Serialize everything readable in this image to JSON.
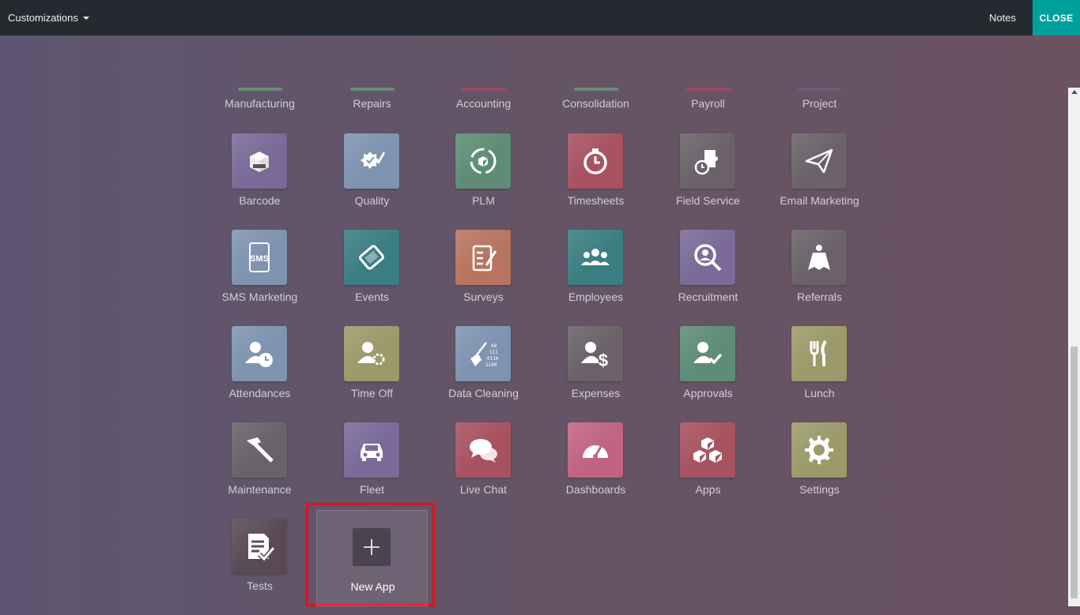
{
  "topbar": {
    "menu_label": "Customizations",
    "notes_label": "Notes",
    "close_label": "CLOSE"
  },
  "partial_row": [
    {
      "label": "Manufacturing",
      "color": "#6a8a74"
    },
    {
      "label": "Repairs",
      "color": "#6a8a74"
    },
    {
      "label": "Accounting",
      "color": "#9a4a62"
    },
    {
      "label": "Consolidation",
      "color": "#6a8a74"
    },
    {
      "label": "Payroll",
      "color": "#9a4a62"
    },
    {
      "label": "Project",
      "color": "#6a5a7a"
    }
  ],
  "apps": [
    {
      "label": "Barcode",
      "icon": "barcode-box-icon",
      "color": "#7a6a98"
    },
    {
      "label": "Quality",
      "icon": "quality-badge-icon",
      "color": "#7e93b0"
    },
    {
      "label": "PLM",
      "icon": "plm-cycle-icon",
      "color": "#5e8c76"
    },
    {
      "label": "Timesheets",
      "icon": "stopwatch-icon",
      "color": "#a85260"
    },
    {
      "label": "Field Service",
      "icon": "puzzle-stopwatch-icon",
      "color": "#6a6268"
    },
    {
      "label": "Email Marketing",
      "icon": "paper-plane-icon",
      "color": "#6a6268"
    },
    {
      "label": "SMS Marketing",
      "icon": "sms-phone-icon",
      "color": "#7e93b0"
    },
    {
      "label": "Events",
      "icon": "ticket-icon",
      "color": "#3a7e82"
    },
    {
      "label": "Surveys",
      "icon": "clipboard-check-icon",
      "color": "#b87460"
    },
    {
      "label": "Employees",
      "icon": "people-group-icon",
      "color": "#3a7e82"
    },
    {
      "label": "Recruitment",
      "icon": "magnifier-person-icon",
      "color": "#7a6a98"
    },
    {
      "label": "Referrals",
      "icon": "hero-cape-icon",
      "color": "#6a6268"
    },
    {
      "label": "Attendances",
      "icon": "person-clock-icon",
      "color": "#7e93b0"
    },
    {
      "label": "Time Off",
      "icon": "person-sun-icon",
      "color": "#9c9a6a"
    },
    {
      "label": "Data Cleaning",
      "icon": "broom-binary-icon",
      "color": "#7e93b0"
    },
    {
      "label": "Expenses",
      "icon": "person-dollar-icon",
      "color": "#6a6268"
    },
    {
      "label": "Approvals",
      "icon": "person-check-icon",
      "color": "#5e8c76"
    },
    {
      "label": "Lunch",
      "icon": "fork-knife-icon",
      "color": "#9c9a6a"
    },
    {
      "label": "Maintenance",
      "icon": "hammer-wrench-icon",
      "color": "#6a6268"
    },
    {
      "label": "Fleet",
      "icon": "car-icon",
      "color": "#7a6a98"
    },
    {
      "label": "Live Chat",
      "icon": "chat-bubbles-icon",
      "color": "#a85260"
    },
    {
      "label": "Dashboards",
      "icon": "gauge-icon",
      "color": "#c06482"
    },
    {
      "label": "Apps",
      "icon": "cubes-icon",
      "color": "#a85260"
    },
    {
      "label": "Settings",
      "icon": "gear-icon",
      "color": "#9c9a6a"
    },
    {
      "label": "Tests",
      "icon": "document-check-icon",
      "color": "#5a4a56"
    }
  ],
  "new_app": {
    "label": "New App",
    "icon": "plus-icon"
  }
}
